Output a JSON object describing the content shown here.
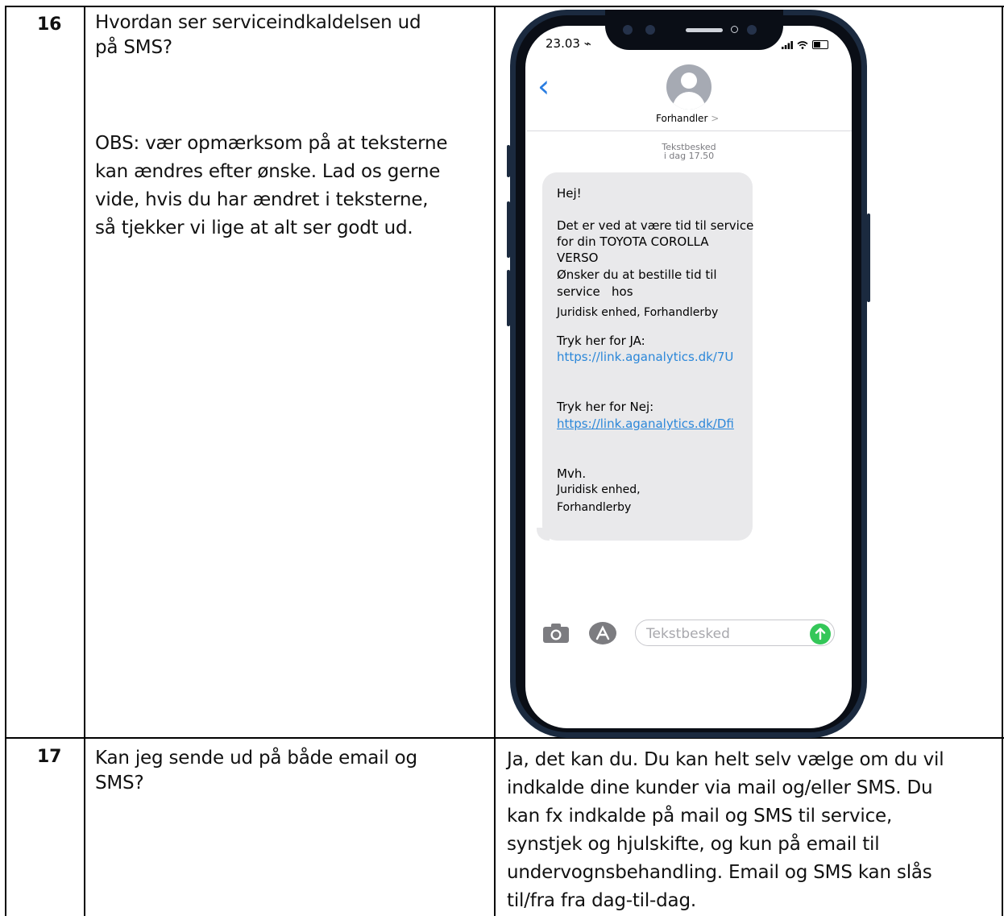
{
  "rows": [
    {
      "number": "16",
      "question_lines": [
        "Hvordan ser serviceindkaldelsen ud",
        "på SMS?"
      ],
      "note_lines": [
        "OBS: vær opmærksom på at teksterne",
        "kan ændres efter ønske. Lad os gerne",
        "vide, hvis du har ændret i teksterne,",
        "så tjekker vi lige at alt ser godt ud."
      ]
    },
    {
      "number": "17",
      "question_lines": [
        "Kan jeg sende ud på både email og",
        "SMS?"
      ],
      "answer_lines": [
        "Ja, det kan du. Du kan helt selv vælge om du vil",
        "indkalde dine kunder via mail og/eller SMS. Du",
        "kan fx indkalde på mail og SMS til service,",
        "synstjek og hjulskifte, og kun på email til",
        "undervognsbehandling. Email og SMS kan slås",
        "til/fra fra dag-til-dag."
      ]
    }
  ],
  "phone": {
    "status_time": "23.03 ⌁",
    "contact_name": "Forhandler",
    "contact_chevron": ">",
    "meta_label": "Tekstbesked",
    "meta_time": "i dag 17.50",
    "message_lines": [
      "Hej!",
      "Det er ved at være tid til service",
      "for din TOYOTA COROLLA",
      "VERSO",
      "Ønsker du at bestille tid til",
      "service   hos",
      "Juridisk enhed, Forhandlerby",
      "Tryk her for JA:",
      "https://link.aganalytics.dk/7U",
      "Tryk her for Nej:",
      "https://link.aganalytics.dk/Dfi",
      "Mvh.",
      "Juridisk enhed,",
      "Forhandlerby"
    ],
    "input_placeholder": "Tekstbesked",
    "icons": [
      "back-chevron-icon",
      "avatar-icon",
      "camera-icon",
      "app-store-icon",
      "send-arrow-icon",
      "signal-icon",
      "wifi-icon",
      "battery-icon"
    ],
    "accent_color": "#2a7de1",
    "link_color": "#2b87d9",
    "send_color": "#34c759",
    "bubble_color": "#e9e9eb",
    "frame_color": "#1b2a3f"
  }
}
